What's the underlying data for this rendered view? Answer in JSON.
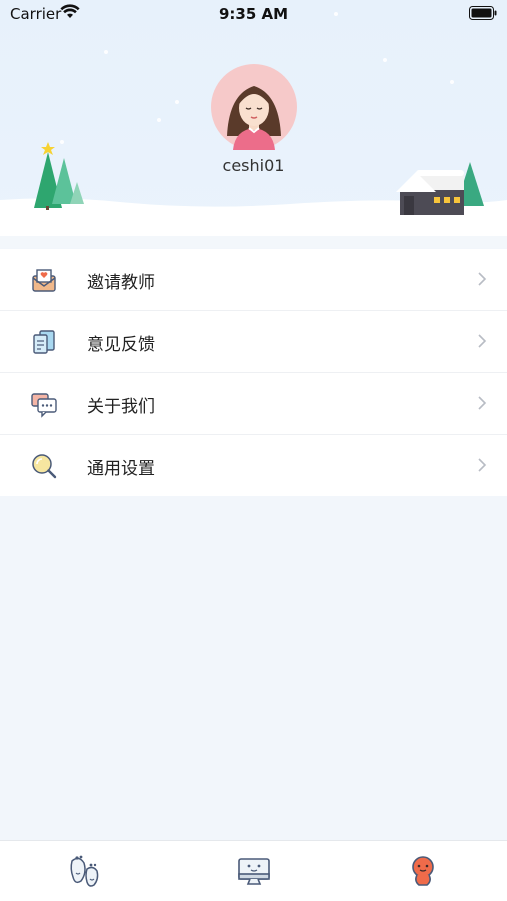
{
  "status_bar": {
    "carrier": "Carrier",
    "time": "9:35 AM"
  },
  "profile": {
    "username": "ceshi01"
  },
  "menu": {
    "items": [
      {
        "label": "邀请教师",
        "icon": "envelope-heart-icon"
      },
      {
        "label": "意见反馈",
        "icon": "feedback-document-icon"
      },
      {
        "label": "关于我们",
        "icon": "chat-bubbles-icon"
      },
      {
        "label": "通用设置",
        "icon": "magnifier-settings-icon"
      }
    ]
  },
  "tab_bar": {
    "tabs": [
      {
        "icon": "footprints-icon"
      },
      {
        "icon": "monitor-icon"
      },
      {
        "icon": "profile-mascot-icon",
        "active": true
      }
    ]
  },
  "colors": {
    "header_bg": "#e7f1fb",
    "page_bg": "#f2f6fb",
    "tree_green": "#3aa981",
    "accent_orange": "#ef6b4a"
  }
}
